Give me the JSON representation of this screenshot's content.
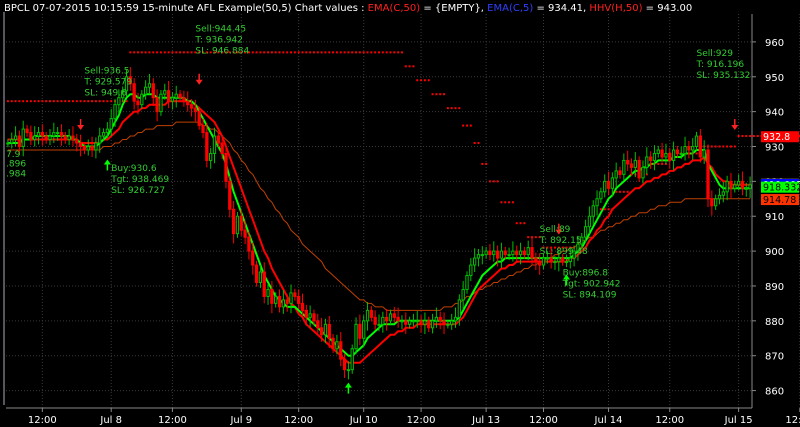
{
  "header": {
    "title": "BPCL 07-07-2015 10:15:59 15-minute AFL Example(50,5) Chart values : ",
    "ema_c50_label": "EMA(C,50)",
    "ema_c50_value": " = {EMPTY}, ",
    "ema_c5_label": "EMA(C,5)",
    "ema_c5_value": " = 934.41, ",
    "hhv_label": "HHV(H,50)",
    "hhv_value": " = 943.00"
  },
  "colors": {
    "background": "#000000",
    "grid": "#3a3a3a",
    "axis_text": "#ffffff",
    "bull": "#00c000",
    "bear": "#ff0000",
    "ema_fast": "#00ff00",
    "ema_mid": "#ff0000",
    "ema_slow": "#c04000",
    "stop_dots": "#ff0000",
    "annot": "#33cc33"
  },
  "chart_data": {
    "type": "candlestick",
    "ylim": [
      855,
      968
    ],
    "y_ticks": [
      860,
      870,
      880,
      890,
      900,
      910,
      920,
      930,
      940,
      950,
      960
    ],
    "x_ticks": [
      {
        "label": "12:00",
        "bar": 9
      },
      {
        "label": "Jul 8",
        "bar": 27
      },
      {
        "label": "12:00",
        "bar": 43
      },
      {
        "label": "Jul 9",
        "bar": 61
      },
      {
        "label": "12:00",
        "bar": 76
      },
      {
        "label": "Jul 10",
        "bar": 93
      },
      {
        "label": "12:00",
        "bar": 108
      },
      {
        "label": "Jul 13",
        "bar": 125
      },
      {
        "label": "12:00",
        "bar": 140
      },
      {
        "label": "Jul 14",
        "bar": 157
      },
      {
        "label": "12:00",
        "bar": 173
      },
      {
        "label": "Jul 15",
        "bar": 191
      },
      {
        "label": "12:00",
        "bar": 207
      }
    ],
    "right_value_tags": [
      {
        "text": "932.8",
        "value": 932.8,
        "bg": "#ff0000",
        "fg": "#ffffff"
      },
      {
        "text": "919.15",
        "value": 919.15,
        "bg": "#ffffff",
        "fg": "#000000"
      },
      {
        "text": "919.095",
        "value": 919.095,
        "bg": "#0000ff",
        "fg": "#ffffff"
      },
      {
        "text": "918.332",
        "value": 918.332,
        "bg": "#00ff00",
        "fg": "#000000"
      },
      {
        "text": "914.78",
        "value": 914.78,
        "bg": "#ff3300",
        "fg": "#000000"
      }
    ],
    "left_edge_values": [
      {
        "text": "7.9",
        "value": 927.0
      },
      {
        "text": ".896",
        "value": 924.2
      },
      {
        "text": ".984",
        "value": 921.4
      }
    ],
    "closes": [
      931,
      932,
      933,
      930,
      935,
      934,
      932,
      933,
      934,
      933,
      932,
      933,
      934,
      934,
      933,
      932,
      933,
      932,
      931,
      930,
      929,
      930,
      929,
      931,
      933,
      934,
      935,
      938,
      942,
      944,
      946,
      950,
      948,
      943,
      942,
      945,
      947,
      948,
      944,
      940,
      945,
      946,
      943,
      944,
      945,
      944,
      943,
      942,
      941,
      940,
      936,
      934,
      926,
      928,
      933,
      931,
      928,
      920,
      912,
      905,
      910,
      906,
      904,
      900,
      896,
      891,
      894,
      887,
      889,
      885,
      887,
      884,
      886,
      885,
      888,
      887,
      885,
      883,
      881,
      882,
      880,
      878,
      876,
      879,
      875,
      872,
      874,
      869,
      866,
      866,
      872,
      879,
      875,
      880,
      883,
      881,
      879,
      879,
      881,
      880,
      882,
      881,
      880,
      880,
      879,
      880,
      880,
      880,
      879,
      880,
      878,
      880,
      881,
      880,
      879,
      879,
      880,
      881,
      886,
      889,
      893,
      896,
      898,
      899,
      899,
      900,
      899,
      900,
      898,
      900,
      899,
      899,
      900,
      899,
      900,
      899,
      901,
      898,
      897,
      896,
      898,
      898,
      897,
      897,
      898,
      897,
      897,
      898,
      900,
      902,
      904,
      907,
      910,
      913,
      915,
      917,
      920,
      918,
      921,
      923,
      922,
      926,
      925,
      924,
      926,
      921,
      924,
      927,
      926,
      928,
      929,
      927,
      928,
      926,
      929,
      928,
      928,
      930,
      929,
      930,
      933,
      927,
      929,
      915,
      913,
      915,
      916,
      917,
      920,
      918,
      919,
      920,
      918,
      918,
      919
    ],
    "ema_fast": [
      931,
      931,
      931,
      931,
      932,
      932,
      932,
      933,
      933,
      933,
      933,
      933,
      933,
      933,
      933,
      933,
      933,
      932,
      932,
      931,
      930,
      930,
      930,
      930,
      931,
      932,
      933,
      935,
      937,
      939,
      942,
      944,
      945,
      945,
      944,
      944,
      945,
      945,
      945,
      944,
      944,
      944,
      944,
      944,
      944,
      944,
      944,
      943,
      943,
      942,
      940,
      938,
      936,
      934,
      932,
      930,
      928,
      925,
      921,
      917,
      914,
      911,
      908,
      905,
      902,
      899,
      896,
      893,
      891,
      889,
      887,
      886,
      885,
      884,
      884,
      884,
      883,
      882,
      881,
      880,
      879,
      878,
      877,
      876,
      875,
      874,
      873,
      872,
      871,
      870,
      870,
      871,
      872,
      873,
      875,
      876,
      877,
      878,
      879,
      879,
      879,
      879,
      880,
      880,
      880,
      880,
      880,
      880,
      880,
      880,
      880,
      880,
      880,
      880,
      880,
      880,
      880,
      880,
      881,
      883,
      885,
      887,
      889,
      891,
      893,
      894,
      895,
      896,
      897,
      897,
      898,
      898,
      898,
      898,
      898,
      898,
      898,
      898,
      898,
      898,
      898,
      898,
      898,
      898,
      898,
      898,
      898,
      898,
      899,
      900,
      901,
      903,
      905,
      907,
      909,
      911,
      913,
      915,
      916,
      918,
      919,
      920,
      921,
      922,
      923,
      923,
      924,
      924,
      925,
      925,
      926,
      926,
      926,
      926,
      927,
      927,
      927,
      928,
      928,
      928,
      929,
      929,
      929,
      925,
      923,
      921,
      919,
      918,
      918,
      918,
      918,
      918,
      918,
      918,
      918
    ],
    "ema_mid": [
      932,
      932,
      932,
      932,
      932,
      932,
      932,
      932,
      932,
      932,
      932,
      932,
      932,
      932,
      932,
      932,
      932,
      932,
      932,
      931,
      931,
      931,
      931,
      931,
      931,
      932,
      932,
      933,
      934,
      935,
      937,
      938,
      939,
      940,
      940,
      941,
      941,
      942,
      942,
      942,
      942,
      942,
      943,
      943,
      943,
      943,
      943,
      943,
      943,
      942,
      941,
      940,
      939,
      938,
      937,
      935,
      933,
      930,
      927,
      924,
      921,
      918,
      915,
      912,
      909,
      906,
      903,
      900,
      898,
      895,
      893,
      891,
      889,
      887,
      885,
      884,
      882,
      881,
      879,
      878,
      877,
      876,
      875,
      874,
      873,
      872,
      871,
      870,
      869,
      868,
      868,
      868,
      868,
      869,
      870,
      871,
      872,
      873,
      874,
      875,
      876,
      876,
      877,
      877,
      878,
      878,
      878,
      879,
      879,
      879,
      879,
      879,
      879,
      879,
      879,
      879,
      879,
      879,
      880,
      881,
      883,
      885,
      887,
      889,
      890,
      891,
      892,
      893,
      894,
      895,
      895,
      896,
      896,
      897,
      897,
      897,
      897,
      897,
      897,
      897,
      897,
      897,
      897,
      897,
      897,
      897,
      897,
      898,
      898,
      899,
      900,
      901,
      903,
      904,
      906,
      907,
      909,
      910,
      912,
      913,
      914,
      915,
      916,
      917,
      918,
      918,
      919,
      920,
      920,
      921,
      921,
      922,
      922,
      923,
      923,
      924,
      924,
      925,
      925,
      926,
      926,
      926,
      927,
      925,
      924,
      922,
      921,
      920,
      920,
      919,
      919,
      919,
      919,
      919,
      919
    ],
    "ema_slow": [
      929,
      929,
      929,
      929,
      929,
      929,
      929,
      929,
      929,
      929,
      929,
      929,
      929,
      929,
      929,
      929,
      929,
      929,
      929,
      929,
      929,
      929,
      929,
      929,
      929,
      930,
      930,
      930,
      931,
      931,
      932,
      932,
      933,
      933,
      934,
      934,
      935,
      935,
      935,
      936,
      936,
      936,
      936,
      936,
      937,
      937,
      937,
      937,
      937,
      937,
      937,
      936,
      936,
      935,
      935,
      934,
      933,
      932,
      931,
      929,
      928,
      926,
      925,
      923,
      922,
      920,
      918,
      917,
      915,
      914,
      912,
      911,
      909,
      908,
      906,
      905,
      904,
      902,
      901,
      900,
      899,
      898,
      897,
      895,
      894,
      893,
      892,
      891,
      890,
      889,
      888,
      887,
      886,
      886,
      885,
      885,
      884,
      884,
      884,
      883,
      883,
      883,
      883,
      883,
      883,
      883,
      883,
      883,
      883,
      883,
      883,
      883,
      883,
      883,
      884,
      884,
      884,
      885,
      885,
      886,
      887,
      887,
      888,
      889,
      889,
      890,
      890,
      891,
      891,
      892,
      892,
      893,
      893,
      894,
      894,
      895,
      895,
      896,
      896,
      897,
      897,
      898,
      898,
      899,
      899,
      900,
      900,
      901,
      901,
      902,
      903,
      903,
      904,
      904,
      905,
      906,
      906,
      907,
      907,
      908,
      908,
      909,
      909,
      910,
      910,
      911,
      911,
      911,
      912,
      912,
      913,
      913,
      913,
      914,
      914,
      914,
      914,
      915,
      915,
      915,
      915,
      915,
      915,
      915,
      915,
      915,
      915,
      915,
      915,
      915,
      915,
      915,
      915,
      915,
      915
    ],
    "stop_dots": [
      {
        "from": 0,
        "to": 31,
        "value": 943
      },
      {
        "from": 32,
        "to": 103,
        "value": 957
      },
      {
        "from": 104,
        "to": 106,
        "value": 953
      },
      {
        "from": 107,
        "to": 110,
        "value": 949
      },
      {
        "from": 111,
        "to": 114,
        "value": 945
      },
      {
        "from": 115,
        "to": 118,
        "value": 941
      },
      {
        "from": 119,
        "to": 121,
        "value": 936
      },
      {
        "from": 122,
        "to": 123,
        "value": 931
      },
      {
        "from": 124,
        "to": 125,
        "value": 925
      },
      {
        "from": 126,
        "to": 128,
        "value": 920
      },
      {
        "from": 129,
        "to": 132,
        "value": 914
      },
      {
        "from": 133,
        "to": 135,
        "value": 908
      },
      {
        "from": 136,
        "to": 139,
        "value": 904
      },
      {
        "from": 140,
        "to": 150,
        "value": 901
      },
      {
        "from": 155,
        "to": 158,
        "value": 912
      },
      {
        "from": 159,
        "to": 162,
        "value": 917
      },
      {
        "from": 163,
        "to": 167,
        "value": 922
      },
      {
        "from": 168,
        "to": 172,
        "value": 925
      },
      {
        "from": 173,
        "to": 181,
        "value": 928
      },
      {
        "from": 182,
        "to": 190,
        "value": 930
      },
      {
        "from": 191,
        "to": 207,
        "value": 933
      }
    ],
    "signals": [
      {
        "type": "sell",
        "bar": 19,
        "price": 935
      },
      {
        "type": "buy",
        "bar": 26,
        "price": 926
      },
      {
        "type": "sell",
        "bar": 50,
        "price": 948
      },
      {
        "type": "buy",
        "bar": 89,
        "price": 862
      },
      {
        "type": "sell",
        "bar": 144,
        "price": 905
      },
      {
        "type": "buy",
        "bar": 146,
        "price": 893
      },
      {
        "type": "sell",
        "bar": 190,
        "price": 935
      }
    ],
    "annotations": [
      {
        "bar": 20,
        "price": 951.0,
        "lines": [
          "Sell:936.5",
          "T: 929.579",
          "SL: 949.6"
        ]
      },
      {
        "bar": 49,
        "price": 963.0,
        "lines": [
          "Sell:944.45",
          "T: 936.942",
          "SL: 946.884"
        ]
      },
      {
        "bar": 27,
        "price": 923.0,
        "lines": [
          "Buy:930.6",
          "Tgt: 938.469",
          "SL: 926.727"
        ]
      },
      {
        "bar": 139,
        "price": 905.5,
        "lines": [
          "Sell:89",
          "T: 892.15",
          "SL: 899.48"
        ]
      },
      {
        "bar": 145,
        "price": 893.0,
        "lines": [
          "Buy:896.8",
          "Tgt: 902.942",
          "SL: 894.109"
        ]
      },
      {
        "bar": 180,
        "price": 956.0,
        "lines": [
          "Sell:929",
          "T: 916.196",
          "SL: 935.132"
        ]
      }
    ]
  }
}
